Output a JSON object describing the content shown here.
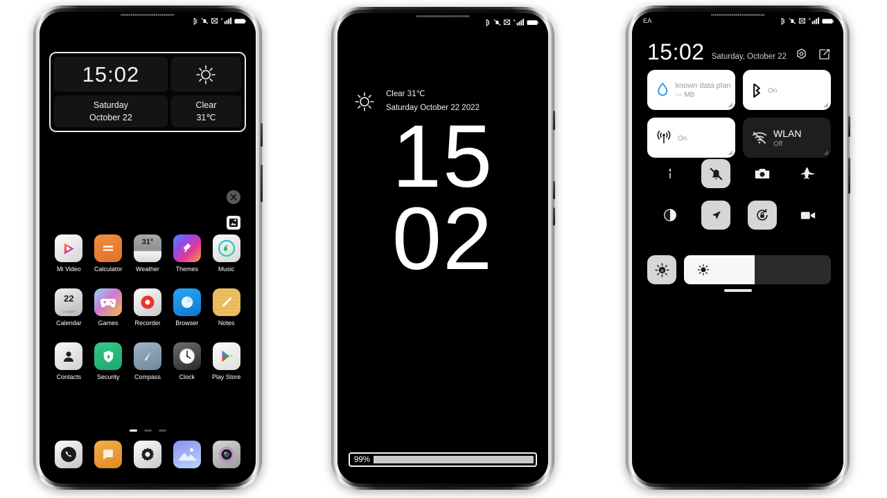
{
  "scene": {
    "background": "#ffffff",
    "device_count": 3
  },
  "status_bar": {
    "icons": [
      "bluetooth-icon",
      "mute-bell-icon",
      "vibrate-off-icon",
      "signal-bars-icon",
      "battery-icon"
    ],
    "network_label": "E"
  },
  "phone1": {
    "name": "home-screen",
    "widget": {
      "time": "15:02",
      "weather_icon": "sun-icon",
      "day": "Saturday",
      "date": "October 22",
      "condition": "Clear",
      "temperature": "31℃",
      "selected_border_color": "#e9e9e9"
    },
    "floating": {
      "close": "close-icon",
      "save": "save-image-icon"
    },
    "app_rows": [
      [
        {
          "label": "Mi Video",
          "icon": "mi-video-icon"
        },
        {
          "label": "Calculator",
          "icon": "calculator-icon"
        },
        {
          "label": "Weather",
          "icon": "weather-icon",
          "badge": "31°"
        },
        {
          "label": "Themes",
          "icon": "themes-icon"
        },
        {
          "label": "Music",
          "icon": "music-icon"
        }
      ],
      [
        {
          "label": "Calendar",
          "icon": "calendar-icon",
          "badge": "22"
        },
        {
          "label": "Games",
          "icon": "games-icon"
        },
        {
          "label": "Recorder",
          "icon": "recorder-icon"
        },
        {
          "label": "Browser",
          "icon": "browser-icon"
        },
        {
          "label": "Notes",
          "icon": "notes-icon"
        }
      ],
      [
        {
          "label": "Contacts",
          "icon": "contacts-icon"
        },
        {
          "label": "Security",
          "icon": "security-icon"
        },
        {
          "label": "Compass",
          "icon": "compass-icon"
        },
        {
          "label": "Clock",
          "icon": "clock-icon"
        },
        {
          "label": "Play Store",
          "icon": "play-store-icon"
        }
      ]
    ],
    "page_indicator": {
      "count": 3,
      "active": 0
    },
    "dock": [
      {
        "label": "Phone",
        "icon": "phone-icon"
      },
      {
        "label": "Messages",
        "icon": "messages-icon"
      },
      {
        "label": "Settings",
        "icon": "settings-icon"
      },
      {
        "label": "Gallery",
        "icon": "gallery-icon"
      },
      {
        "label": "Camera",
        "icon": "camera-icon"
      }
    ]
  },
  "phone2": {
    "name": "always-on-display",
    "weather_icon": "sun-icon",
    "weather_line": "Clear 31℃",
    "date_line": "Saturday October 22 2022",
    "clock_hours": "15",
    "clock_minutes": "02",
    "battery_percent": "99%",
    "battery_level": 99
  },
  "phone3": {
    "name": "control-center",
    "carrier": "EA",
    "time": "15:02",
    "date": "Saturday, October 22",
    "header_icons": [
      "settings-gear-icon",
      "edit-icon"
    ],
    "tiles": [
      {
        "name": "data-plan",
        "icon": "data-droplet-icon",
        "title": "known data plan",
        "subtitle": "--- MB",
        "state": "on",
        "title_muted": true
      },
      {
        "name": "bluetooth",
        "icon": "bluetooth-icon",
        "title": "",
        "subtitle": "On",
        "state": "on",
        "title_muted": true
      },
      {
        "name": "mobile-data",
        "icon": "mobile-data-icon",
        "title": "",
        "subtitle": "On",
        "state": "on",
        "title_muted": true
      },
      {
        "name": "wlan",
        "icon": "wifi-off-icon",
        "title": "WLAN",
        "subtitle": "Off",
        "state": "off",
        "title_muted": false
      }
    ],
    "toggles": [
      {
        "name": "flashlight",
        "icon": "flashlight-icon",
        "active": false
      },
      {
        "name": "silent-mode",
        "icon": "bell-off-icon",
        "active": true
      },
      {
        "name": "screenshot",
        "icon": "camera-icon",
        "active": false
      },
      {
        "name": "airplane-mode",
        "icon": "airplane-icon",
        "active": false
      },
      {
        "name": "dark-mode",
        "icon": "contrast-icon",
        "active": false
      },
      {
        "name": "location",
        "icon": "location-arrow-icon",
        "active": true
      },
      {
        "name": "rotation-lock",
        "icon": "rotation-lock-icon",
        "active": true
      },
      {
        "name": "screen-recorder",
        "icon": "video-camera-icon",
        "active": false
      }
    ],
    "brightness": {
      "auto_icon": "auto-brightness-icon",
      "slider_icon": "brightness-sun-icon",
      "level": 48
    },
    "handle": "drag-handle"
  }
}
